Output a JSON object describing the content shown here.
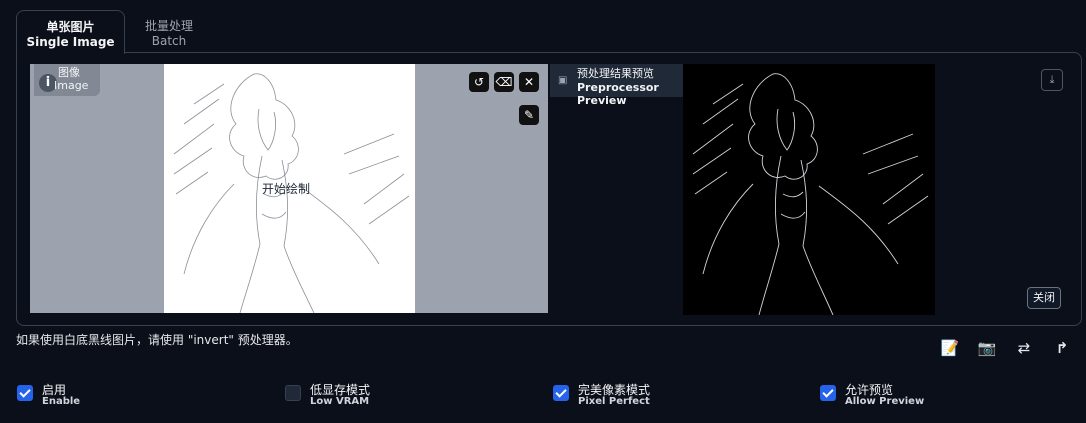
{
  "tabs": [
    {
      "zh": "单张图片",
      "en": "Single Image"
    },
    {
      "zh": "批量处理",
      "en": "Batch"
    }
  ],
  "image_panel": {
    "label_zh": "图像",
    "label_en": "Image",
    "info": "i",
    "canvas_text": "开始绘制",
    "tools": [
      "undo-icon",
      "eraser-icon",
      "close-icon",
      "brush-icon"
    ]
  },
  "preview_panel": {
    "label_zh": "预处理结果预览",
    "label_en": "Preprocessor Preview",
    "close_label": "关闭"
  },
  "hint": "如果使用白底黑线图片，请使用 \"invert\" 预处理器。",
  "options": [
    {
      "zh": "启用",
      "en": "Enable",
      "checked": true
    },
    {
      "zh": "低显存模式",
      "en": "Low VRAM",
      "checked": false
    },
    {
      "zh": "完美像素模式",
      "en": "Pixel Perfect",
      "checked": true
    },
    {
      "zh": "允许预览",
      "en": "Allow Preview",
      "checked": true
    }
  ],
  "bottom_icons": [
    "edit-icon",
    "camera-icon",
    "swap-icon",
    "send-up-icon"
  ],
  "colors": {
    "bg": "#0b0f19",
    "accent": "#2563eb",
    "border": "#374151"
  }
}
